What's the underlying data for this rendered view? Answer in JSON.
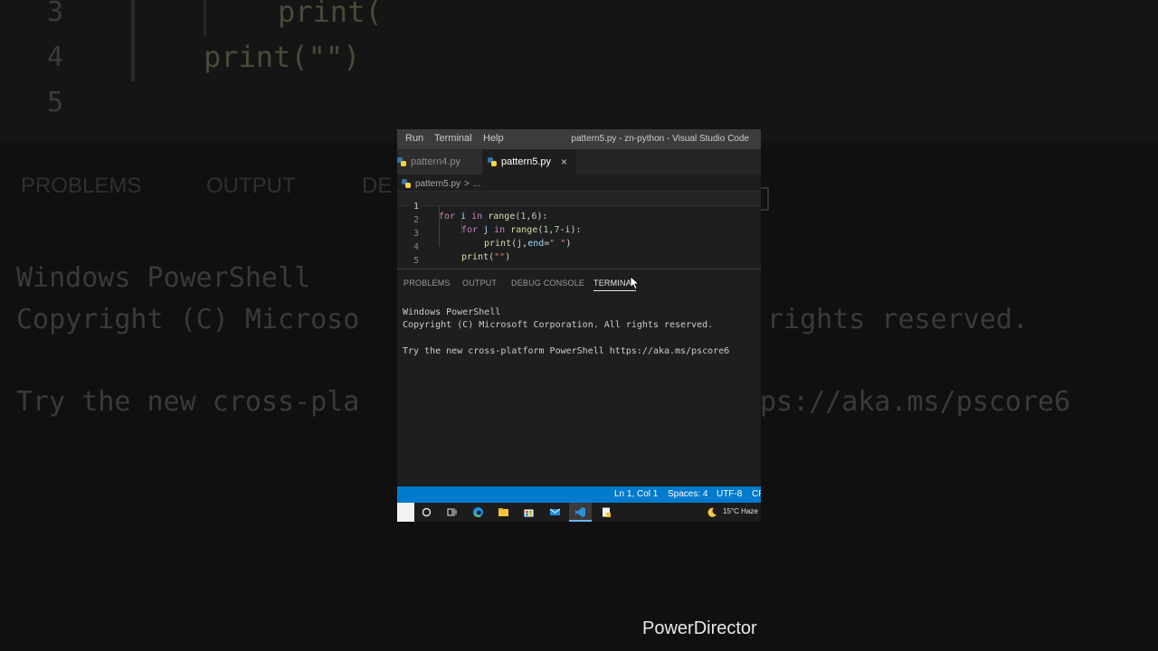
{
  "background": {
    "line_numbers": [
      "3",
      "4",
      "5"
    ],
    "code_lines": [
      "print(",
      "print(\"\")"
    ],
    "panel_tabs": [
      "PROBLEMS",
      "OUTPUT",
      "DE"
    ],
    "terminal_lines": [
      "Windows PowerShell",
      "Copyright (C) Microso",
      "rights reserved.",
      "Try the new cross-pla",
      "ps://aka.ms/pscore6"
    ]
  },
  "window": {
    "menu": [
      "Run",
      "Terminal",
      "Help"
    ],
    "title": "pattern5.py - zn-python - Visual Studio Code"
  },
  "tabs": [
    {
      "label": "pattern4.py",
      "active": false
    },
    {
      "label": "pattern5.py",
      "active": true
    }
  ],
  "tab_close": "×",
  "breadcrumb": {
    "file": "pattern5.py",
    "sep": ">",
    "rest": "..."
  },
  "editor": {
    "line_numbers": [
      "1",
      "2",
      "3",
      "4",
      "5"
    ]
  },
  "panel": {
    "tabs": [
      "PROBLEMS",
      "OUTPUT",
      "DEBUG CONSOLE",
      "TERMINAL"
    ],
    "active_tab": "TERMINAL",
    "terminal": [
      "Windows PowerShell",
      "Copyright (C) Microsoft Corporation. All rights reserved.",
      "Try the new cross-platform PowerShell https://aka.ms/pscore6"
    ]
  },
  "status": {
    "position": "Ln 1, Col 1",
    "spaces": "Spaces: 4",
    "encoding": "UTF-8",
    "eol": "CR"
  },
  "taskbar": {
    "weather": "15°C  Haze"
  },
  "watermark": "PowerDirector",
  "colors": {
    "accent": "#007acc",
    "titlebar": "#3c3c3c",
    "editor_bg": "#1e1e1e"
  }
}
